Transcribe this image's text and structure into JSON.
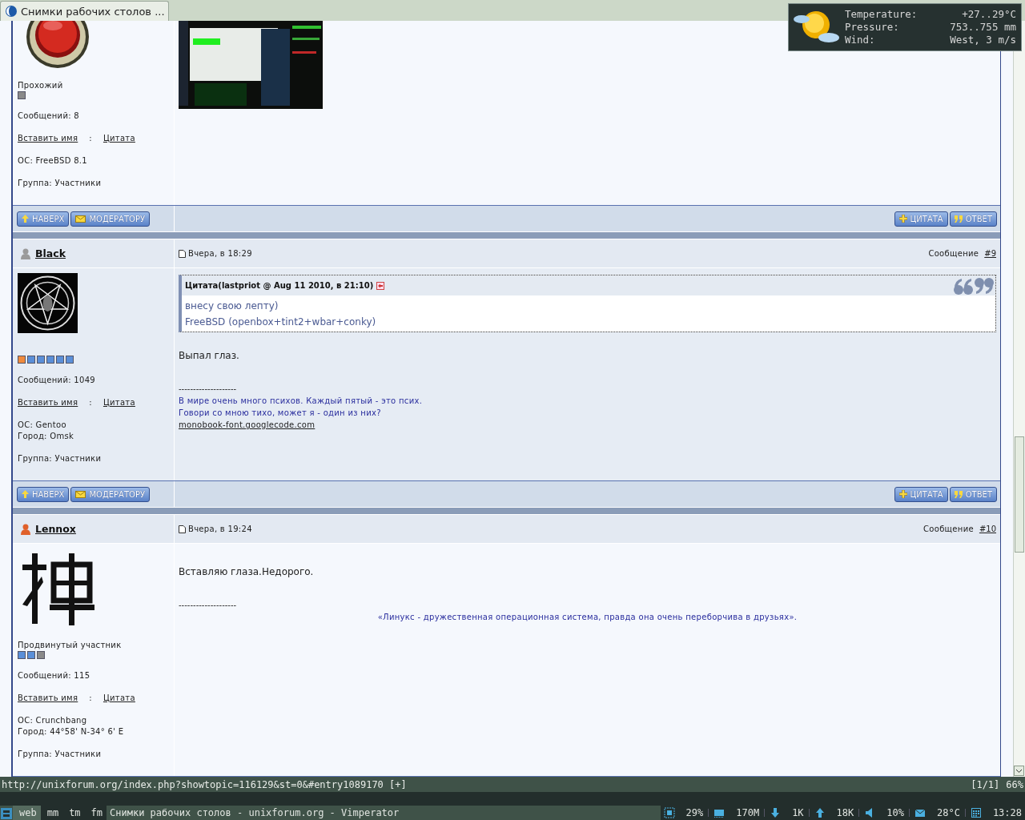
{
  "browser_tab": {
    "title": "Снимки рабочих столов ...",
    "selected": true
  },
  "weather": [
    {
      "label": "Temperature:",
      "value": "+27..29°C"
    },
    {
      "label": "Pressure:",
      "value": "753..755 mm"
    },
    {
      "label": "Wind:",
      "value": "West, 3 m/s"
    }
  ],
  "posts": [
    {
      "shaded": false,
      "avatar": {
        "kind": "badge"
      },
      "rank": "Прохожий",
      "pips": [
        {
          "color": "#8a8a8a"
        }
      ],
      "count": "Сообщений: 8",
      "insert_name": "Вставить имя",
      "separator": ":",
      "quote_link": "Цитата",
      "details": [
        "ОС: FreeBSD 8.1"
      ],
      "group": "Группа: Участники",
      "body": {
        "picture": true
      },
      "buttons_left": [
        {
          "kind": "up",
          "label": "НАВЕРХ"
        },
        {
          "kind": "mail",
          "label": "МОДЕРАТОРУ"
        }
      ],
      "buttons_right": [
        {
          "kind": "plus",
          "label": "ЦИТАТА"
        },
        {
          "kind": "quote",
          "label": "ОТВЕТ"
        }
      ]
    },
    {
      "shaded": true,
      "header": {
        "author": "Black",
        "color": "#9a9a9a",
        "date": "Вчера, в 18:29",
        "number_label": "Сообщение",
        "number": "#9"
      },
      "avatar": {
        "kind": "pentagram"
      },
      "pips": [
        {
          "color": "#f08a3c"
        },
        {
          "color": "#5b8fd8"
        },
        {
          "color": "#5b8fd8"
        },
        {
          "color": "#5b8fd8"
        },
        {
          "color": "#5b8fd8"
        },
        {
          "color": "#5b8fd8"
        }
      ],
      "count": "Сообщений: 1049",
      "insert_name": "Вставить имя",
      "separator": ":",
      "quote_link": "Цитата",
      "details": [
        "ОС: Gentoo",
        "Город: Omsk"
      ],
      "group": "Группа: Участники",
      "body": {
        "quote": {
          "title": "Цитата(lastpriot @ Aug 11 2010, в 21:10)",
          "lines": [
            "внесу свою лепту)",
            "FreeBSD (openbox+tint2+wbar+conky)"
          ]
        },
        "text": "Выпал глаз.",
        "signature": {
          "rule": "--------------------",
          "centered": false,
          "lines": [
            "В мире очень много психов. Каждый пятый - это псих.",
            "Говори со мною тихо, может я - один из них?"
          ],
          "link": "monobook-font.googlecode.com"
        }
      },
      "buttons_left": [
        {
          "kind": "up",
          "label": "НАВЕРХ"
        },
        {
          "kind": "mail",
          "label": "МОДЕРАТОРУ"
        }
      ],
      "buttons_right": [
        {
          "kind": "plus",
          "label": "ЦИТАТА"
        },
        {
          "kind": "quote",
          "label": "ОТВЕТ"
        }
      ]
    },
    {
      "shaded": false,
      "header": {
        "author": "Lennox",
        "color": "#e0602a",
        "date": "Вчера, в 19:24",
        "number_label": "Сообщение",
        "number": "#10"
      },
      "avatar": {
        "kind": "brush"
      },
      "rank": "Продвинутый участник",
      "pips": [
        {
          "color": "#5b8fd8"
        },
        {
          "color": "#5b8fd8"
        },
        {
          "color": "#8a8a8a"
        }
      ],
      "count": "Сообщений: 115",
      "insert_name": "Вставить имя",
      "separator": ":",
      "quote_link": "Цитата",
      "details": [
        "ОС: Crunchbang",
        "Город: 44°58' N-34° 6' E"
      ],
      "group": "Группа: Участники",
      "body": {
        "text": "Вставляю глаза.Недорого.",
        "signature": {
          "rule": "--------------------",
          "centered": true,
          "lines": [
            "«Линукс - дружественная операционная система, правда она очень переборчива в друзьях»."
          ]
        }
      }
    }
  ],
  "statusline": {
    "url": "http://unixforum.org/index.php?showtopic=116129&st=0&#entry1089170 [+]",
    "position": "[1/1]",
    "zoom": "66%"
  },
  "panel": {
    "tags": [
      {
        "label": "web",
        "selected": true
      },
      {
        "label": "mm",
        "selected": false
      },
      {
        "label": "tm",
        "selected": false
      },
      {
        "label": "fm",
        "selected": false
      }
    ],
    "title": "Снимки рабочих столов - unixforum.org - Vimperator",
    "stats": [
      {
        "kind": "cpu",
        "value": "29%"
      },
      {
        "kind": "memory",
        "value": "170M"
      },
      {
        "kind": "download",
        "value": "1K"
      },
      {
        "kind": "upload",
        "value": "18K"
      },
      {
        "kind": "volume",
        "value": "10%"
      },
      {
        "kind": "mail",
        "value": "28°C"
      },
      {
        "kind": "calendar",
        "value": "13:28"
      }
    ]
  }
}
